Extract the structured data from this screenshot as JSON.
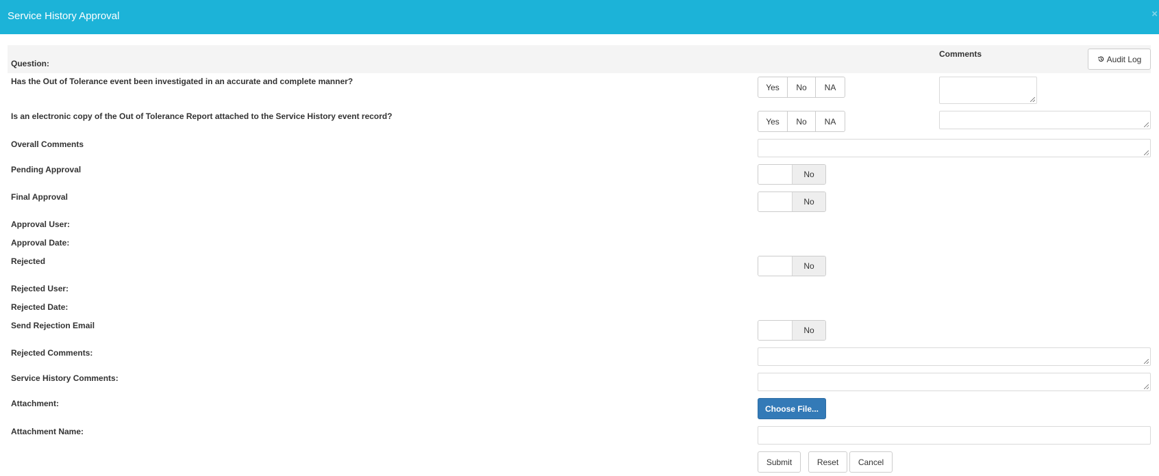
{
  "modal": {
    "title": "Service History Approval",
    "close_glyph": "×"
  },
  "table_header": {
    "question": "Question:",
    "comments": "Comments",
    "audit_log": "Audit Log",
    "audit_icon": "history-icon"
  },
  "questions": [
    {
      "text": "Has the Out of Tolerance event been investigated in an accurate and complete manner?",
      "options": [
        "Yes",
        "No",
        "NA"
      ]
    },
    {
      "text": "Is an electronic copy of the Out of Tolerance Report attached to the Service History event record?",
      "options": [
        "Yes",
        "No",
        "NA"
      ]
    }
  ],
  "fields": {
    "overall_comments": "Overall Comments",
    "pending_approval": "Pending Approval",
    "pending_approval_value": "No",
    "final_approval": "Final Approval",
    "final_approval_value": "No",
    "approval_user": "Approval User:",
    "approval_date": "Approval Date:",
    "rejected": "Rejected",
    "rejected_value": "No",
    "rejected_user": "Rejected User:",
    "rejected_date": "Rejected Date:",
    "send_rejection_email": "Send Rejection Email",
    "send_rejection_email_value": "No",
    "rejected_comments": "Rejected Comments:",
    "service_history_comments": "Service History Comments:",
    "attachment": "Attachment:",
    "choose_file": "Choose File...",
    "attachment_name": "Attachment Name:"
  },
  "actions": {
    "submit": "Submit",
    "reset": "Reset",
    "cancel": "Cancel"
  },
  "colors": {
    "header_bg": "#1cb3d8",
    "primary_button": "#337ab7",
    "question_header_bg": "#f4f4f4"
  }
}
